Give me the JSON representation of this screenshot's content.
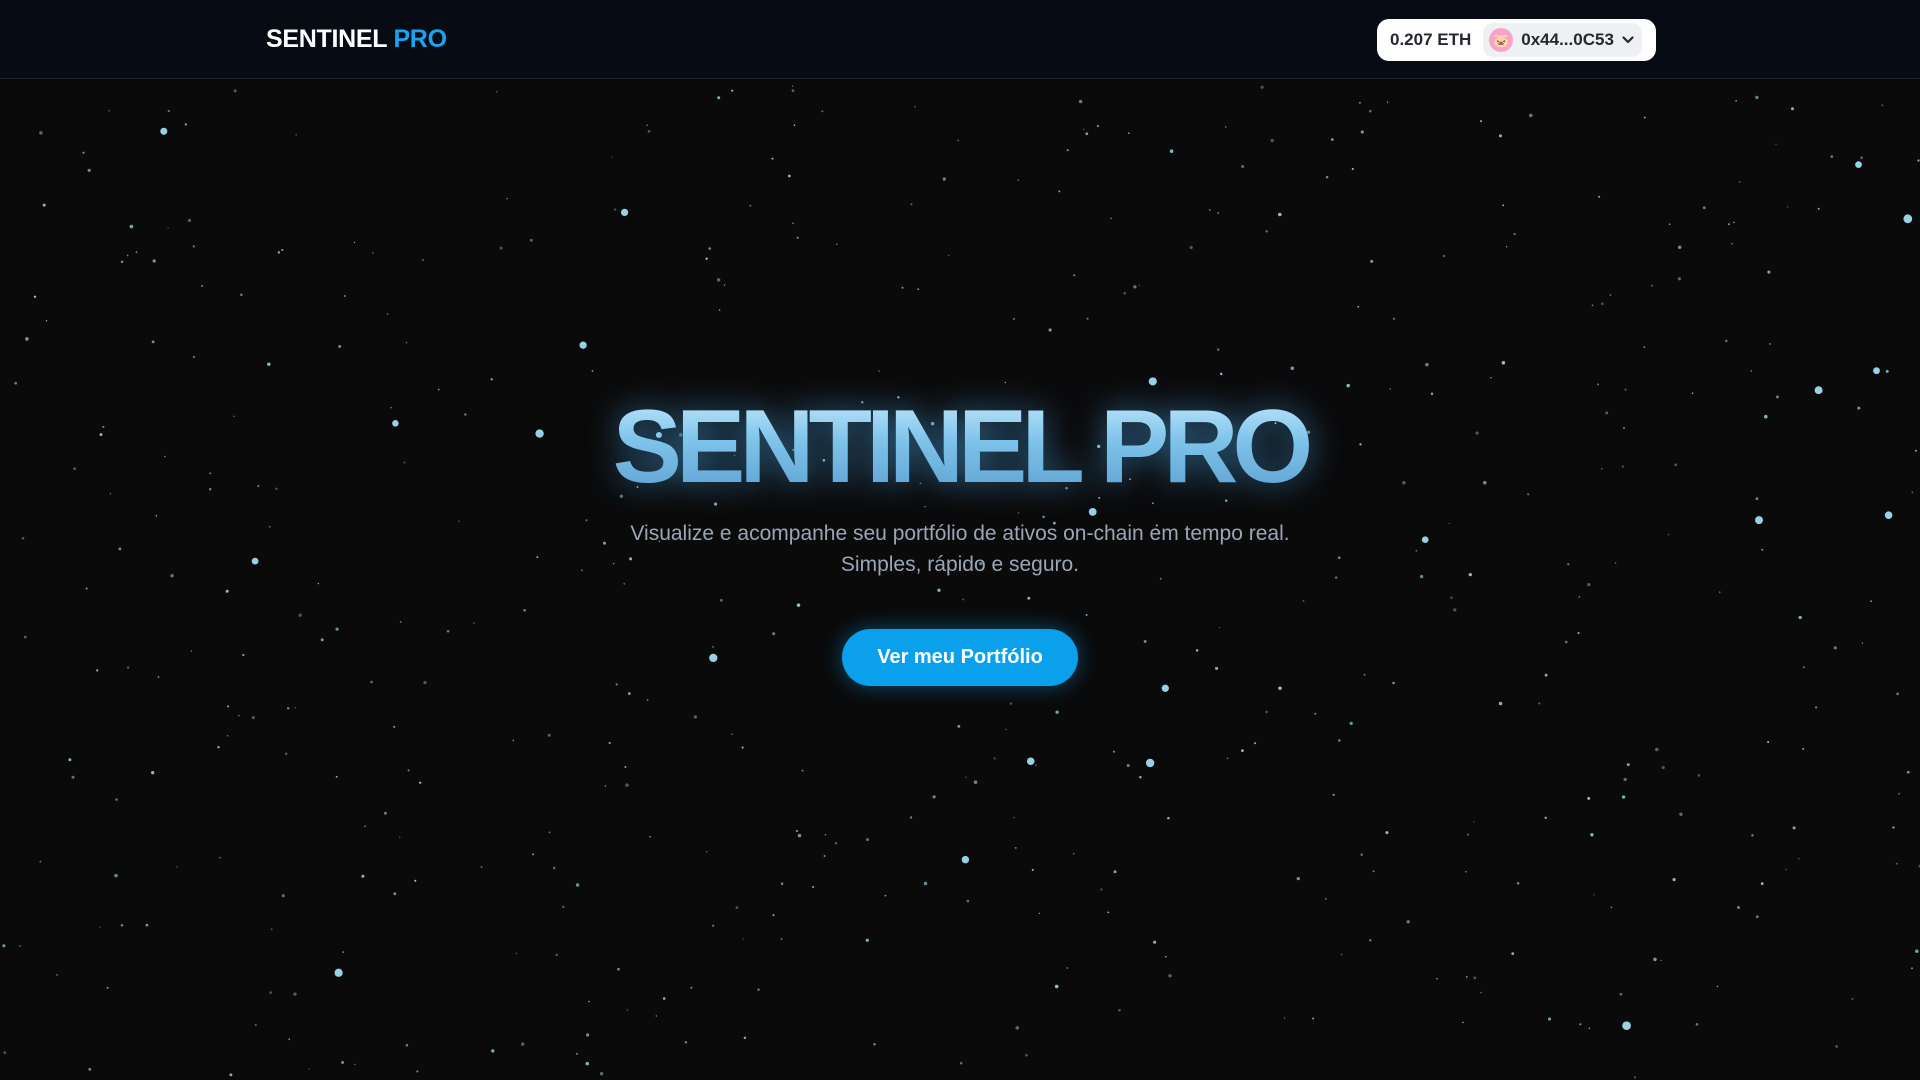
{
  "header": {
    "brand_main": "SENTINEL",
    "brand_accent": "PRO",
    "wallet": {
      "balance": "0.207 ETH",
      "avatar_icon": "pig-emoji-icon",
      "avatar_glyph": "🐷",
      "address": "0x44...0C53",
      "dropdown_icon": "chevron-down-icon"
    }
  },
  "hero": {
    "title": "SENTINEL PRO",
    "subtitle_line1": "Visualize e acompanhe seu portfólio de ativos on-chain em tempo real.",
    "subtitle_line2": "Simples, rápido e seguro.",
    "cta_label": "Ver meu Portfólio"
  },
  "colors": {
    "background": "#0a0a0b",
    "navbar": "#070b14",
    "accent": "#1aa3f0",
    "cta": "#0aa0ec",
    "star": "#9fdcf0"
  }
}
